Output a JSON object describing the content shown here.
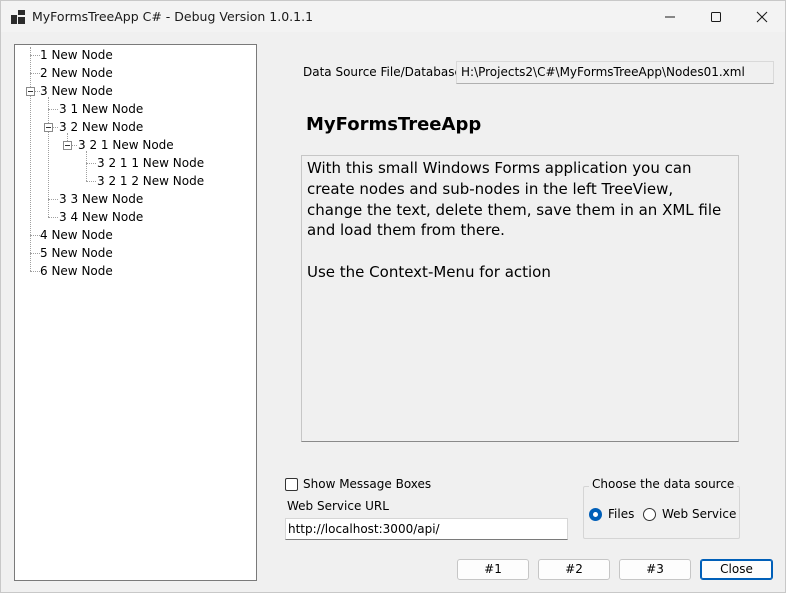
{
  "window": {
    "title": "MyFormsTreeApp C# - Debug Version 1.0.1.1"
  },
  "tree": {
    "nodes": [
      {
        "label": "1 New Node",
        "level": 0
      },
      {
        "label": "2 New Node",
        "level": 0
      },
      {
        "label": "3 New Node",
        "level": 0,
        "expanded": true
      },
      {
        "label": "3 1 New Node",
        "level": 1
      },
      {
        "label": "3 2 New Node",
        "level": 1,
        "expanded": true
      },
      {
        "label": "3 2 1 New Node",
        "level": 2,
        "expanded": true
      },
      {
        "label": "3 2 1 1 New Node",
        "level": 3
      },
      {
        "label": "3 2 1 2 New Node",
        "level": 3
      },
      {
        "label": "3 3 New Node",
        "level": 1
      },
      {
        "label": "3 4 New Node",
        "level": 1
      },
      {
        "label": "4 New Node",
        "level": 0
      },
      {
        "label": "5 New Node",
        "level": 0
      },
      {
        "label": "6 New Node",
        "level": 0
      }
    ]
  },
  "datasource": {
    "label": "Data Source File/Database:",
    "path": "H:\\Projects2\\C#\\MyFormsTreeApp\\Nodes01.xml"
  },
  "main": {
    "app_title": "MyFormsTreeApp",
    "description_line1": "With this small Windows Forms application you can create nodes and sub-nodes in the left TreeView, change the text, delete them, save them in an XML file and load them from there.",
    "description_line2": "Use the Context-Menu for action"
  },
  "options": {
    "show_message_boxes_label": "Show Message Boxes",
    "show_message_boxes_checked": false,
    "web_service_url_label": "Web Service URL",
    "web_service_url_value": "http://localhost:3000/api/"
  },
  "data_source_group": {
    "legend": "Choose the data source",
    "options": [
      {
        "label": "Files",
        "selected": true
      },
      {
        "label": "Web Service",
        "selected": false
      }
    ]
  },
  "buttons": {
    "b1": "#1",
    "b2": "#2",
    "b3": "#3",
    "close": "Close"
  },
  "colors": {
    "accent": "#005fb8",
    "window_bg": "#f0f0f0"
  }
}
